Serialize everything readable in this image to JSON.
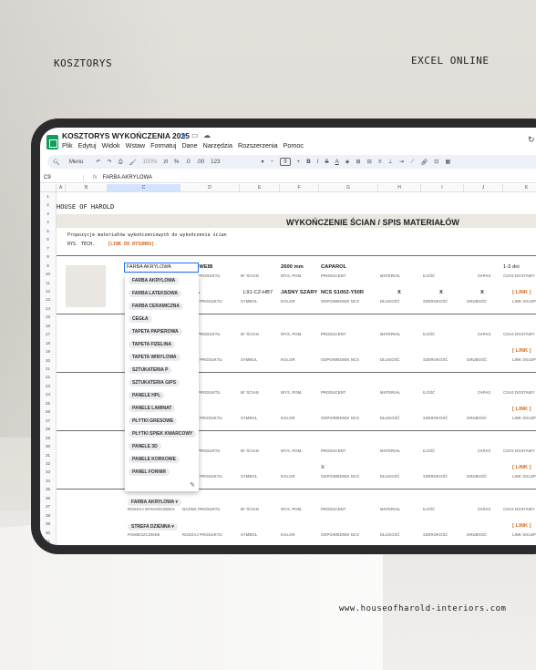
{
  "brand_left": "KOSZTORYS",
  "brand_right": "EXCEL ONLINE",
  "website": "www.houseofharold-interiors.com",
  "app": {
    "title": "KOSZTORYS WYKOŃCZENIA 2025",
    "menu": [
      "Plik",
      "Edytuj",
      "Widok",
      "Wstaw",
      "Formatuj",
      "Dane",
      "Narzędzia",
      "Rozszerzenia",
      "Pomoc"
    ]
  },
  "toolbar": {
    "menu": "Menu",
    "zoom": "100%",
    "zl": "zł",
    "percent": "%",
    "dec_less": ".0",
    "dec_more": ".00",
    "num123": "123",
    "font_size": "9",
    "minus": "−",
    "plus": "+",
    "bold": "B",
    "italic": "I",
    "strike": "S",
    "textcolor": "A"
  },
  "formula": {
    "cell": "C9",
    "fx": "fx",
    "value": "FARBA AKRYLOWA"
  },
  "columns": [
    "A",
    "B",
    "C",
    "D",
    "E",
    "F",
    "G",
    "H",
    "I",
    "J",
    "K"
  ],
  "rows": [
    "1",
    "2",
    "3",
    "4",
    "5",
    "6",
    "7",
    "8",
    "9",
    "10",
    "11",
    "12",
    "13",
    "14",
    "15",
    "16",
    "17",
    "18",
    "19",
    "20",
    "21",
    "22",
    "23",
    "24",
    "25",
    "26",
    "27",
    "28",
    "29",
    "30",
    "31",
    "32",
    "33",
    "34",
    "35",
    "36",
    "37",
    "38",
    "39",
    "40",
    "41"
  ],
  "sheet": {
    "company": "HOUSE OF HAROLD",
    "section_title": "WYKOŃCZENIE ŚCIAN / SPIS MATERIAŁÓW",
    "proposal": "Propozycje materiałów wykończeniowych do wykończenia ścian",
    "drawing_label": "RYS. TECH.",
    "drawing_link": "[LINK DO RYSUNKU]",
    "row1": {
      "product": "WARMWEIB",
      "dim": "2600 mm",
      "producer": "CAPAROL",
      "delivery": "1-3 dni"
    },
    "row2": {
      "type": "FARBA",
      "symbol": "L91-C2-HB7",
      "color": "JASNY SZARY",
      "ncs": "NCS S1002-Y50R",
      "x1": "X",
      "x2": "X",
      "x3": "X",
      "link": "[ LINK ]",
      "shop": "LINK SKLEP"
    },
    "labels": {
      "product_name": "NAZWA PRODUKTU",
      "wall_m": "M² ŚCIAN",
      "height": "WYS. POM.",
      "producer": "PRODUCENT",
      "material": "MATERIAŁ",
      "qty": "ILOŚĆ",
      "stock": "ZAPAS",
      "delivery_time": "CZAS DOSTAWY",
      "product_type": "RODZAJ PRODUKTU",
      "symbol": "SYMBOL",
      "color": "KOLOR",
      "ncs": "ODPOWIEDNIK NCS",
      "length": "DŁUGOŚĆ",
      "width": "SZEROKOŚĆ",
      "thickness": "GRUBOŚĆ",
      "room": "POMIESZCZENIE",
      "product_kind": "RODZAJ WYKOŃCZENIA"
    },
    "link": "[ LINK ]",
    "shop": "LINK SKLEP",
    "x": "X",
    "bottom_chip1": "FARBA AKRYLOWA",
    "bottom_chip2": "STREFA DZIENNA"
  },
  "dropdown": {
    "selected": "FARBA AKRYLOWA",
    "options": [
      "FARBA AKRYLOWA",
      "FARBA LATEKSOWA",
      "FARBA CERAMICZNA",
      "CEGŁA",
      "TAPETA PAPIEROWA",
      "TAPETA FIZELINA",
      "TAPETA WINYLOWA",
      "SZTUKATERIA P",
      "SZTUKATERIA GIPS",
      "PANELE HPL",
      "PANELE LAMINAT",
      "PŁYTKI GRESOWE",
      "PŁYTKI SPIEK KWARCOWY",
      "PANELE 3D",
      "PANELE KORKOWE",
      "PANEL FORNIR"
    ]
  },
  "colors": {
    "accent": "#1a73e8",
    "link": "#d2691e",
    "sheets_green": "#0f9d58"
  }
}
